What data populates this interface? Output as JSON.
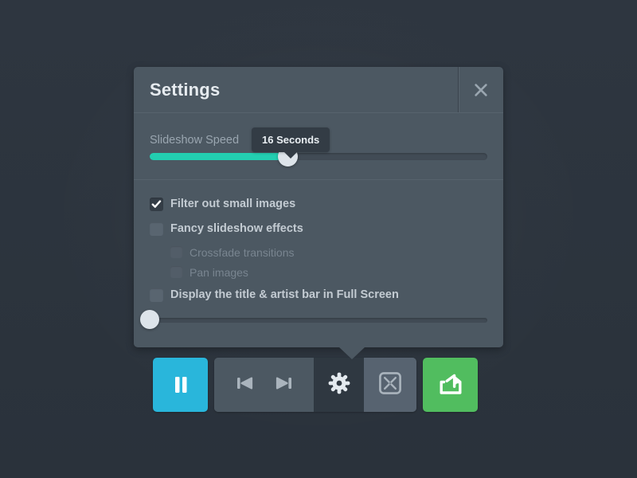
{
  "panel": {
    "title": "Settings",
    "close_icon": "close-icon",
    "speed": {
      "label": "Slideshow Speed",
      "tooltip_value": "16 Seconds",
      "fill_percent": 41,
      "accent_color": "#23ceb1",
      "track_color": "#414b55",
      "thumb_color": "#dde4ea"
    },
    "options": [
      {
        "label": "Filter out small images",
        "checked": true,
        "disabled": false,
        "indent": false
      },
      {
        "label": "Fancy slideshow effects",
        "checked": false,
        "disabled": false,
        "indent": false
      },
      {
        "label": "Crossfade transitions",
        "checked": false,
        "disabled": true,
        "indent": true
      },
      {
        "label": "Pan images",
        "checked": false,
        "disabled": true,
        "indent": true
      },
      {
        "label": "Display the title & artist bar in Full Screen",
        "checked": false,
        "disabled": false,
        "indent": false
      }
    ],
    "bottom_slider": {
      "fill_percent": 0,
      "thumb_color": "#dde4ea",
      "track_color": "#414b55"
    },
    "background_color": "#4c5862",
    "tooltip_color": "#333c45"
  },
  "toolbar": {
    "buttons": [
      {
        "name": "pause-button",
        "icon": "pause-icon",
        "label": "Pause",
        "color": "#29b6db"
      },
      {
        "name": "previous-button",
        "icon": "previous-icon",
        "label": "Previous",
        "color": "#4c5862"
      },
      {
        "name": "next-button",
        "icon": "next-icon",
        "label": "Next",
        "color": "#4c5862"
      },
      {
        "name": "settings-button",
        "icon": "gear-icon",
        "label": "Settings",
        "color": "#2f3841"
      },
      {
        "name": "fullscreen-button",
        "icon": "fullscreen-icon",
        "label": "Full Screen",
        "color": "#576370"
      },
      {
        "name": "share-button",
        "icon": "share-icon",
        "label": "Share",
        "color": "#51bd5f"
      }
    ]
  },
  "app": {
    "background_color": "#2c343e"
  }
}
